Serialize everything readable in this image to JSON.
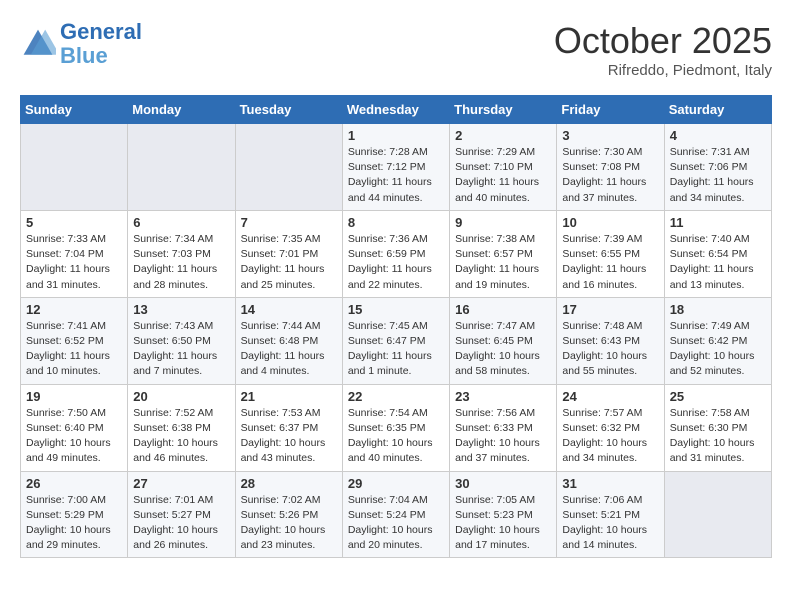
{
  "header": {
    "logo_line1": "General",
    "logo_line2": "Blue",
    "month": "October 2025",
    "location": "Rifreddo, Piedmont, Italy"
  },
  "weekdays": [
    "Sunday",
    "Monday",
    "Tuesday",
    "Wednesday",
    "Thursday",
    "Friday",
    "Saturday"
  ],
  "weeks": [
    [
      {
        "day": "",
        "info": ""
      },
      {
        "day": "",
        "info": ""
      },
      {
        "day": "",
        "info": ""
      },
      {
        "day": "1",
        "info": "Sunrise: 7:28 AM\nSunset: 7:12 PM\nDaylight: 11 hours and 44 minutes."
      },
      {
        "day": "2",
        "info": "Sunrise: 7:29 AM\nSunset: 7:10 PM\nDaylight: 11 hours and 40 minutes."
      },
      {
        "day": "3",
        "info": "Sunrise: 7:30 AM\nSunset: 7:08 PM\nDaylight: 11 hours and 37 minutes."
      },
      {
        "day": "4",
        "info": "Sunrise: 7:31 AM\nSunset: 7:06 PM\nDaylight: 11 hours and 34 minutes."
      }
    ],
    [
      {
        "day": "5",
        "info": "Sunrise: 7:33 AM\nSunset: 7:04 PM\nDaylight: 11 hours and 31 minutes."
      },
      {
        "day": "6",
        "info": "Sunrise: 7:34 AM\nSunset: 7:03 PM\nDaylight: 11 hours and 28 minutes."
      },
      {
        "day": "7",
        "info": "Sunrise: 7:35 AM\nSunset: 7:01 PM\nDaylight: 11 hours and 25 minutes."
      },
      {
        "day": "8",
        "info": "Sunrise: 7:36 AM\nSunset: 6:59 PM\nDaylight: 11 hours and 22 minutes."
      },
      {
        "day": "9",
        "info": "Sunrise: 7:38 AM\nSunset: 6:57 PM\nDaylight: 11 hours and 19 minutes."
      },
      {
        "day": "10",
        "info": "Sunrise: 7:39 AM\nSunset: 6:55 PM\nDaylight: 11 hours and 16 minutes."
      },
      {
        "day": "11",
        "info": "Sunrise: 7:40 AM\nSunset: 6:54 PM\nDaylight: 11 hours and 13 minutes."
      }
    ],
    [
      {
        "day": "12",
        "info": "Sunrise: 7:41 AM\nSunset: 6:52 PM\nDaylight: 11 hours and 10 minutes."
      },
      {
        "day": "13",
        "info": "Sunrise: 7:43 AM\nSunset: 6:50 PM\nDaylight: 11 hours and 7 minutes."
      },
      {
        "day": "14",
        "info": "Sunrise: 7:44 AM\nSunset: 6:48 PM\nDaylight: 11 hours and 4 minutes."
      },
      {
        "day": "15",
        "info": "Sunrise: 7:45 AM\nSunset: 6:47 PM\nDaylight: 11 hours and 1 minute."
      },
      {
        "day": "16",
        "info": "Sunrise: 7:47 AM\nSunset: 6:45 PM\nDaylight: 10 hours and 58 minutes."
      },
      {
        "day": "17",
        "info": "Sunrise: 7:48 AM\nSunset: 6:43 PM\nDaylight: 10 hours and 55 minutes."
      },
      {
        "day": "18",
        "info": "Sunrise: 7:49 AM\nSunset: 6:42 PM\nDaylight: 10 hours and 52 minutes."
      }
    ],
    [
      {
        "day": "19",
        "info": "Sunrise: 7:50 AM\nSunset: 6:40 PM\nDaylight: 10 hours and 49 minutes."
      },
      {
        "day": "20",
        "info": "Sunrise: 7:52 AM\nSunset: 6:38 PM\nDaylight: 10 hours and 46 minutes."
      },
      {
        "day": "21",
        "info": "Sunrise: 7:53 AM\nSunset: 6:37 PM\nDaylight: 10 hours and 43 minutes."
      },
      {
        "day": "22",
        "info": "Sunrise: 7:54 AM\nSunset: 6:35 PM\nDaylight: 10 hours and 40 minutes."
      },
      {
        "day": "23",
        "info": "Sunrise: 7:56 AM\nSunset: 6:33 PM\nDaylight: 10 hours and 37 minutes."
      },
      {
        "day": "24",
        "info": "Sunrise: 7:57 AM\nSunset: 6:32 PM\nDaylight: 10 hours and 34 minutes."
      },
      {
        "day": "25",
        "info": "Sunrise: 7:58 AM\nSunset: 6:30 PM\nDaylight: 10 hours and 31 minutes."
      }
    ],
    [
      {
        "day": "26",
        "info": "Sunrise: 7:00 AM\nSunset: 5:29 PM\nDaylight: 10 hours and 29 minutes."
      },
      {
        "day": "27",
        "info": "Sunrise: 7:01 AM\nSunset: 5:27 PM\nDaylight: 10 hours and 26 minutes."
      },
      {
        "day": "28",
        "info": "Sunrise: 7:02 AM\nSunset: 5:26 PM\nDaylight: 10 hours and 23 minutes."
      },
      {
        "day": "29",
        "info": "Sunrise: 7:04 AM\nSunset: 5:24 PM\nDaylight: 10 hours and 20 minutes."
      },
      {
        "day": "30",
        "info": "Sunrise: 7:05 AM\nSunset: 5:23 PM\nDaylight: 10 hours and 17 minutes."
      },
      {
        "day": "31",
        "info": "Sunrise: 7:06 AM\nSunset: 5:21 PM\nDaylight: 10 hours and 14 minutes."
      },
      {
        "day": "",
        "info": ""
      }
    ]
  ]
}
